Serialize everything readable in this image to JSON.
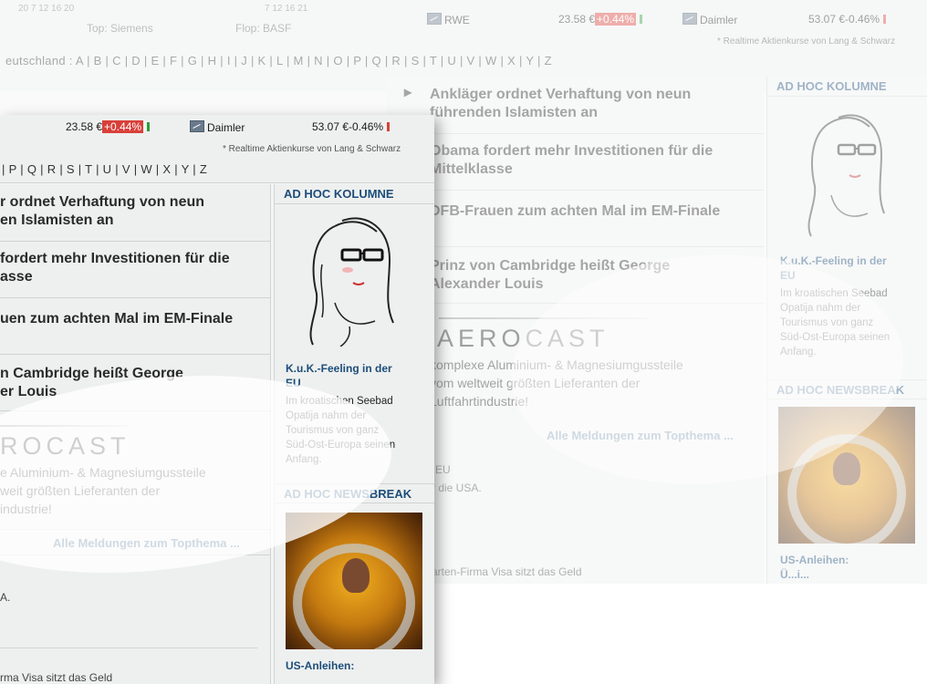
{
  "ticker": {
    "rwe": {
      "name": "RWE",
      "price": "23.58 €",
      "change": "+0.44%"
    },
    "daimler": {
      "name": "Daimler",
      "price": "53.07 €",
      "change": "-0.46%"
    },
    "realtime_note": "* Realtime Aktienkurse von Lang & Schwarz",
    "top_label": "Top: Siemens",
    "flop_label": "Flop: BASF",
    "chart_axis_left": "20      7   12   16   20",
    "chart_axis_right": "7   12   16   21"
  },
  "alphabet_back": "eutschland :  A  |  B  |  C  |  D  |  E  |  F  |  G  |  H  |  I  |  J  |  K  |  L  |  M  |  N  |  O  |  P  |  Q  |  R  |  S  |  T  |  U  |  V  |  W  |  X  |  Y  |  Z",
  "alphabet_front": "|  P  |  Q  |  R  |  S  |  T  |  U  |  V  |  W  |  X  |  Y  |  Z",
  "stories_back": {
    "s1a": "Ankläger ordnet Verhaftung von neun",
    "s1b": "führenden Islamisten an",
    "s2a": "Obama fordert mehr Investitionen für die",
    "s2b": "Mittelklasse",
    "s3": "DFB-Frauen zum achten Mal im EM-Finale",
    "s4a": "Prinz von Cambridge heißt George",
    "s4b": "Alexander Louis"
  },
  "stories_front": {
    "s1a": "r ordnet Verhaftung von neun",
    "s1b": "en Islamisten an",
    "s2a": "fordert mehr Investitionen für die",
    "s2b": "asse",
    "s3": "uen zum achten Mal im EM-Finale",
    "s4a": "n Cambridge heißt George",
    "s4b": "er Louis"
  },
  "aerocast_back": {
    "logo": "AEROCAST",
    "l1": "komplexe Aluminium- & Magnesiumgussteile",
    "l2": "vom weltweit größten Lieferanten der",
    "l3": "Luftfahrtindustrie!"
  },
  "aerocast_front": {
    "logo": "ROCAST",
    "l1": "e Aluminium- & Magnesiumgussteile",
    "l2": "weit größten Lieferanten der",
    "l3": "industrie!"
  },
  "more_link": "Alle Meldungen zum Topthema ...",
  "misc_back": {
    "eu": "er EU",
    "usa": "für die USA.",
    "visa": "rkarten-Firma Visa sitzt das Geld"
  },
  "misc_front": {
    "usa": "A.",
    "visa": "rma Visa sitzt das Geld"
  },
  "sidebar": {
    "kolumne_head": "AD HOC KOLUMNE",
    "kuk_title_1": "K.u.K.-Feeling in der",
    "kuk_title_2": "EU",
    "kuk_text_1": "Im kroatischen Seebad",
    "kuk_text_2": "Opatija nahm der",
    "kuk_text_3": "Tourismus von ganz",
    "kuk_text_4": "Süd-Ost-Europa seinen",
    "kuk_text_5": "Anfang.",
    "newsbreak_head": "AD HOC NEWSBREAK",
    "us_title_front": "US-Anleihen:",
    "us_title_back": "US-Anleihen:",
    "us_title_back_2": "Ü...i..."
  },
  "colors": {
    "accent": "#1d4d7a",
    "negative": "#d9403a",
    "positive": "#2e9c3a"
  }
}
